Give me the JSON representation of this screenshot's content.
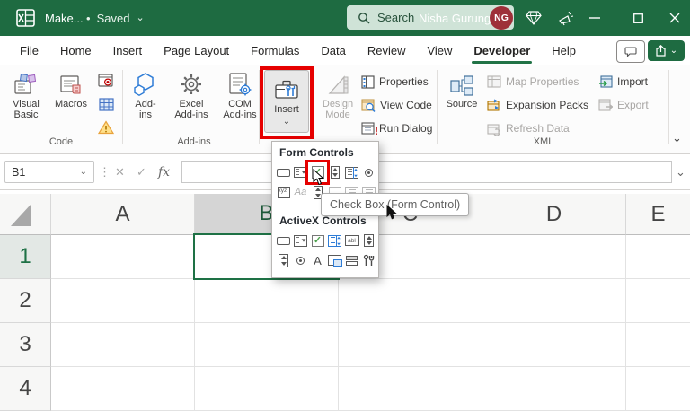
{
  "title_bar": {
    "app_title": "Make...",
    "separator": "•",
    "save_status": "Saved",
    "search_placeholder": "Search",
    "user_name": "Nisha Gurung",
    "user_initials": "NG"
  },
  "menu": {
    "tabs": [
      "File",
      "Home",
      "Insert",
      "Page Layout",
      "Formulas",
      "Data",
      "Review",
      "View",
      "Developer",
      "Help"
    ],
    "active_tab": "Developer"
  },
  "ribbon": {
    "code": {
      "visual_basic": "Visual Basic",
      "macros": "Macros",
      "group_label": "Code"
    },
    "addins": {
      "addins": "Add-ins",
      "excel_addins": "Excel Add-ins",
      "com_addins": "COM Add-ins",
      "group_label": "Add-ins"
    },
    "controls": {
      "insert": "Insert",
      "design_mode": "Design Mode",
      "properties": "Properties",
      "view_code": "View Code",
      "run_dialog": "Run Dialog"
    },
    "xml": {
      "source": "Source",
      "map_properties": "Map Properties",
      "expansion_packs": "Expansion Packs",
      "refresh_data": "Refresh Data",
      "import": "Import",
      "export": "Export",
      "group_label": "XML"
    }
  },
  "formula_bar": {
    "name_box": "B1",
    "fx_label": "fx"
  },
  "insert_menu": {
    "form_controls_header": "Form Controls",
    "activex_header": "ActiveX Controls",
    "tooltip": "Check Box (Form Control)"
  },
  "sheet": {
    "columns": [
      "A",
      "B",
      "C",
      "D",
      "E"
    ],
    "rows": [
      "1",
      "2",
      "3",
      "4"
    ],
    "selected_cell": "B1"
  },
  "icon_texts": {
    "aa": "Aa",
    "abl": "abl",
    "xyz": "xyz",
    "label_a": "A",
    "run_exclamation": "!"
  },
  "colors": {
    "title_bar_green": "#1E6B41",
    "accent_green": "#217346",
    "highlight_red": "#E60000",
    "avatar_maroon": "#9E3039"
  }
}
